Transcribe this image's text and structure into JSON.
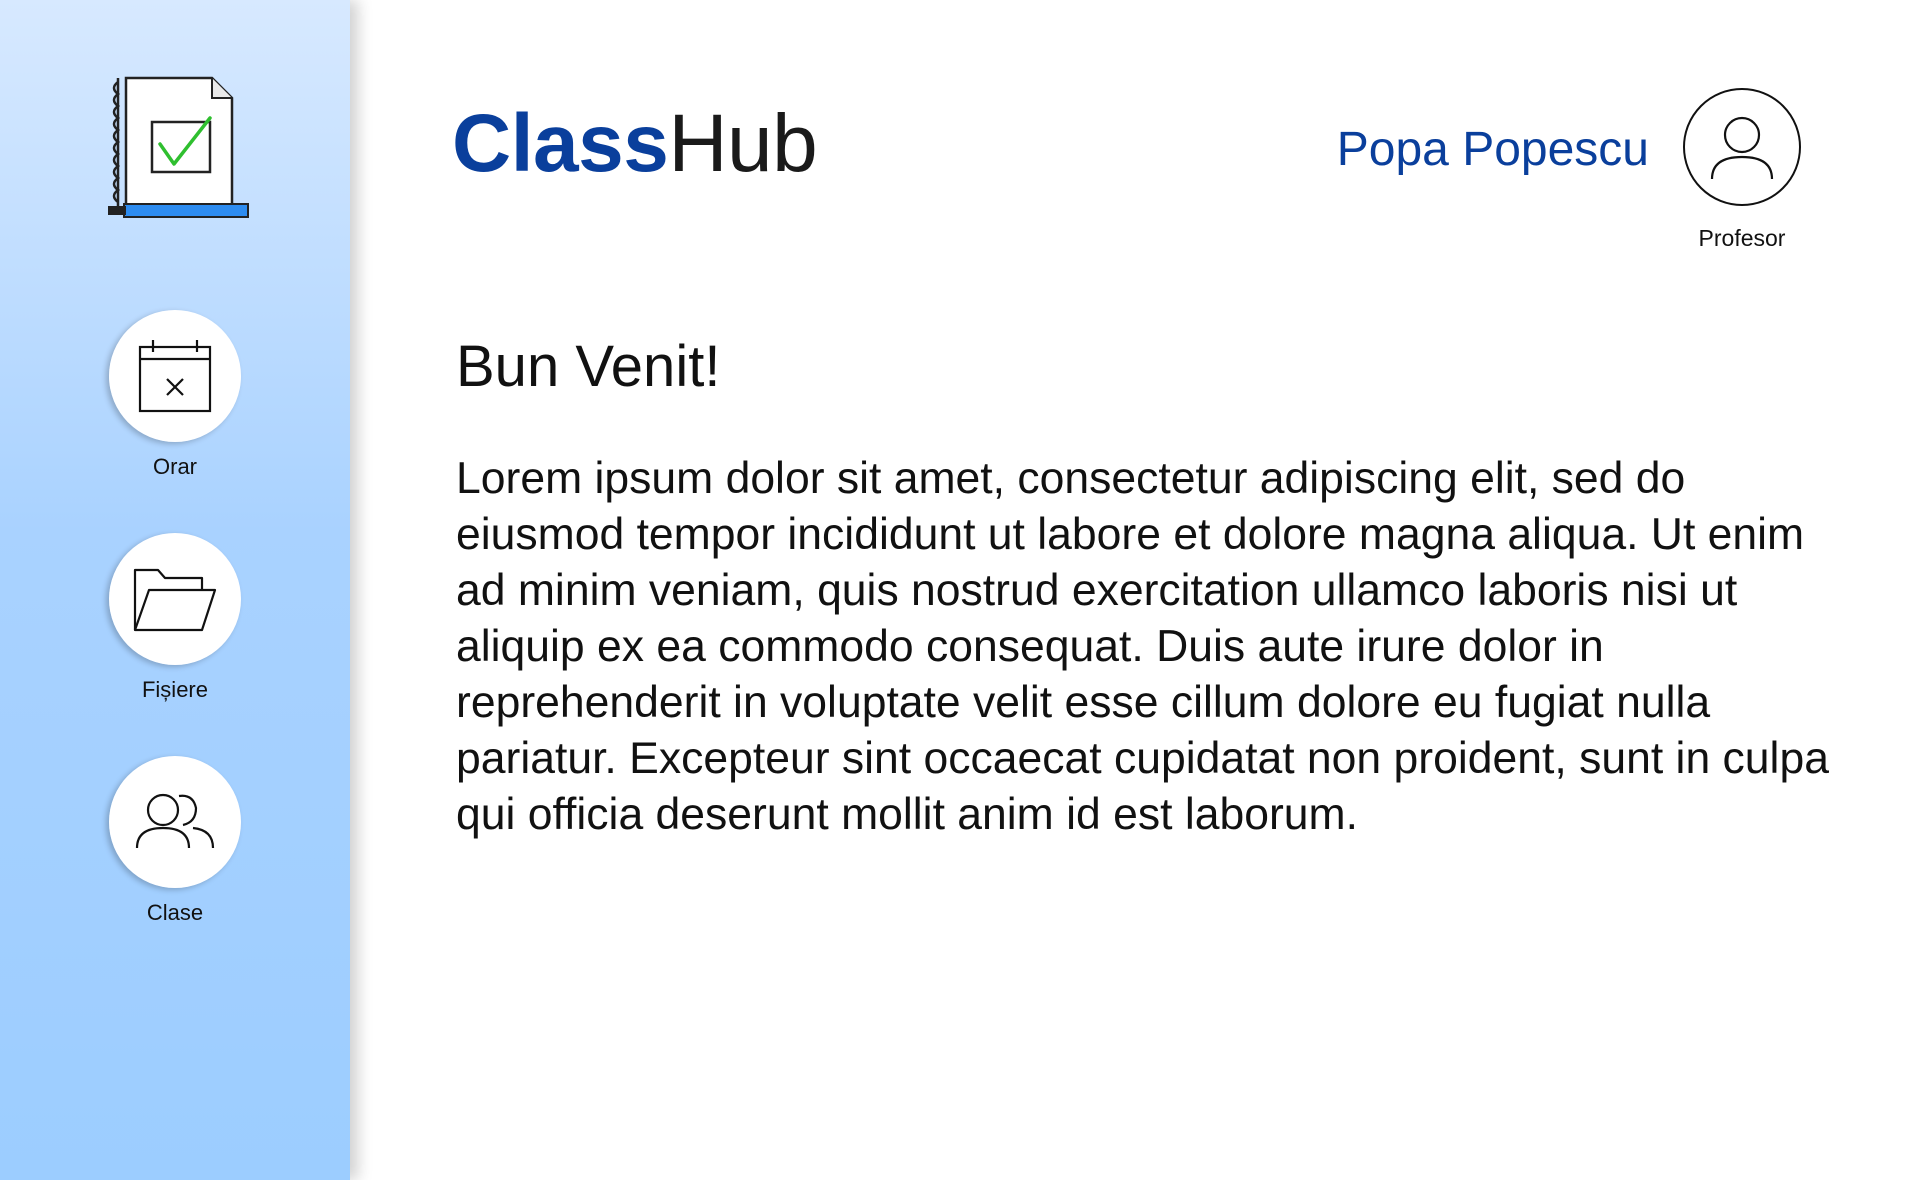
{
  "brand": {
    "bold": "Class",
    "light": "Hub"
  },
  "user": {
    "name": "Popa Popescu",
    "role": "Profesor"
  },
  "sidebar": {
    "items": [
      {
        "label": "Orar",
        "icon": "calendar-icon"
      },
      {
        "label": "Fișiere",
        "icon": "folder-icon"
      },
      {
        "label": "Clase",
        "icon": "users-icon"
      }
    ]
  },
  "main": {
    "heading": "Bun Venit!",
    "body": "Lorem ipsum dolor sit amet, consectetur adipiscing elit, sed do eiusmod tempor incididunt ut labore et dolore magna aliqua. Ut enim ad minim veniam, quis nostrud exercitation ullamco laboris nisi ut aliquip ex ea commodo consequat. Duis aute irure dolor in reprehenderit in voluptate velit esse cillum dolore eu fugiat nulla pariatur. Excepteur sint occaecat cupidatat non proident, sunt in culpa qui officia deserunt mollit anim id est laborum."
  },
  "colors": {
    "brand_blue": "#0a3f9c",
    "sidebar_top": "#d7e9ff",
    "sidebar_bottom": "#9ccdff",
    "check_green": "#2fbf2f",
    "accent_blue": "#2d8cf0"
  }
}
